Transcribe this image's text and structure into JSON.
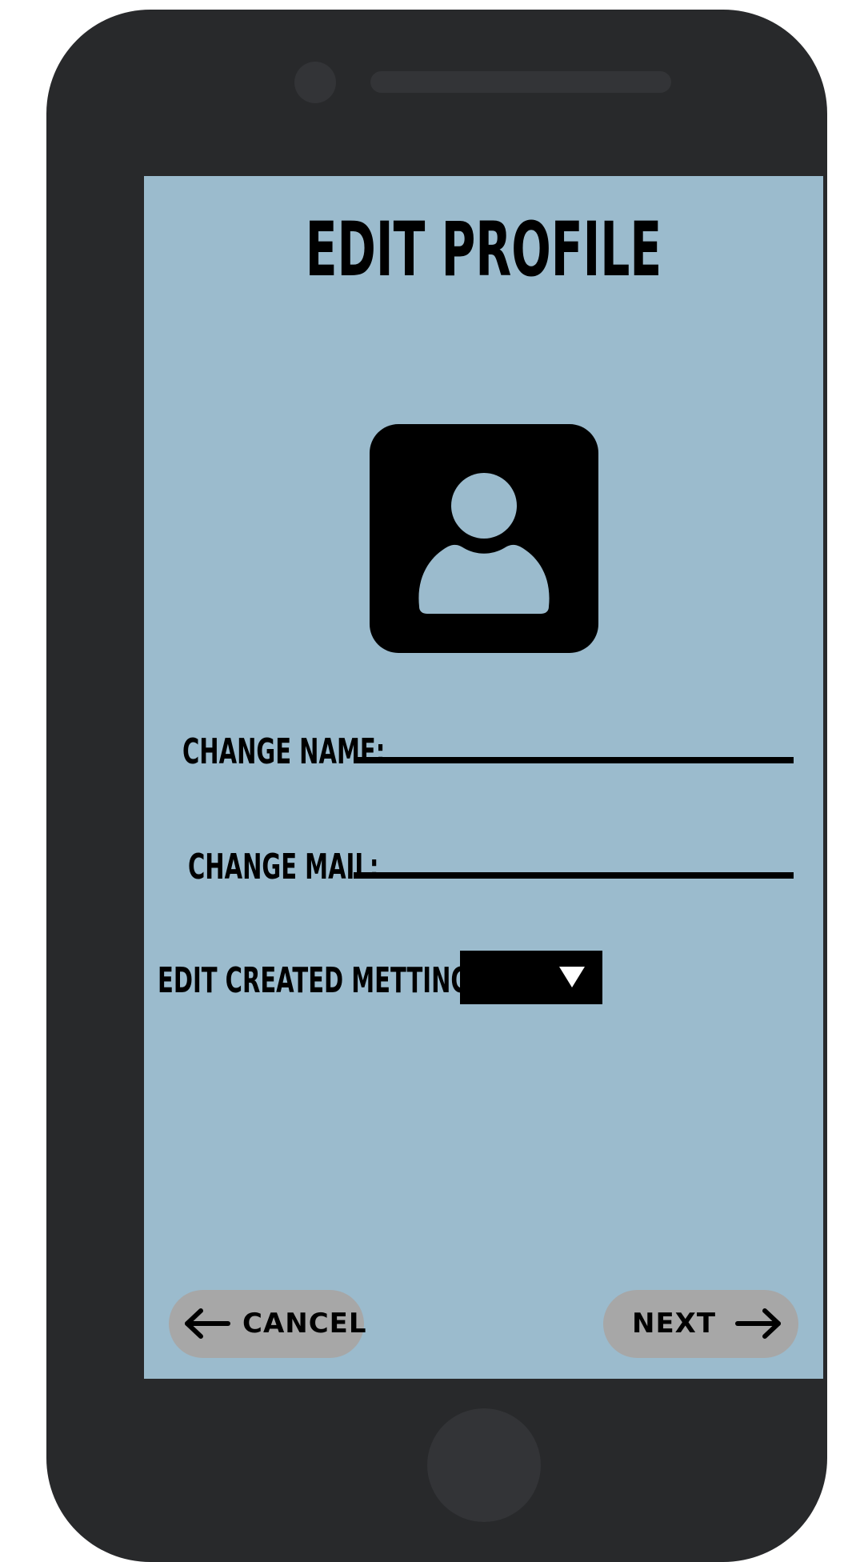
{
  "screen": {
    "title": "EDIT PROFILE",
    "background_color": "#9bbbcd"
  },
  "phone": {
    "body_color": "#28292b"
  },
  "avatar": {
    "icon": "user-profile-icon"
  },
  "form": {
    "name_label": "CHANGE NAME:",
    "name_value": "",
    "mail_label": "CHANGE MAIL:",
    "mail_value": "",
    "meetings_label": "EDIT CREATED METTINGS:",
    "meetings_selected": "",
    "dropdown_icon": "triangle-down-icon"
  },
  "footer": {
    "cancel_label": "CANCEL",
    "cancel_icon": "arrow-left-icon",
    "next_label": "NEXT",
    "next_icon": "arrow-right-icon",
    "button_color": "#a7a7a7"
  }
}
